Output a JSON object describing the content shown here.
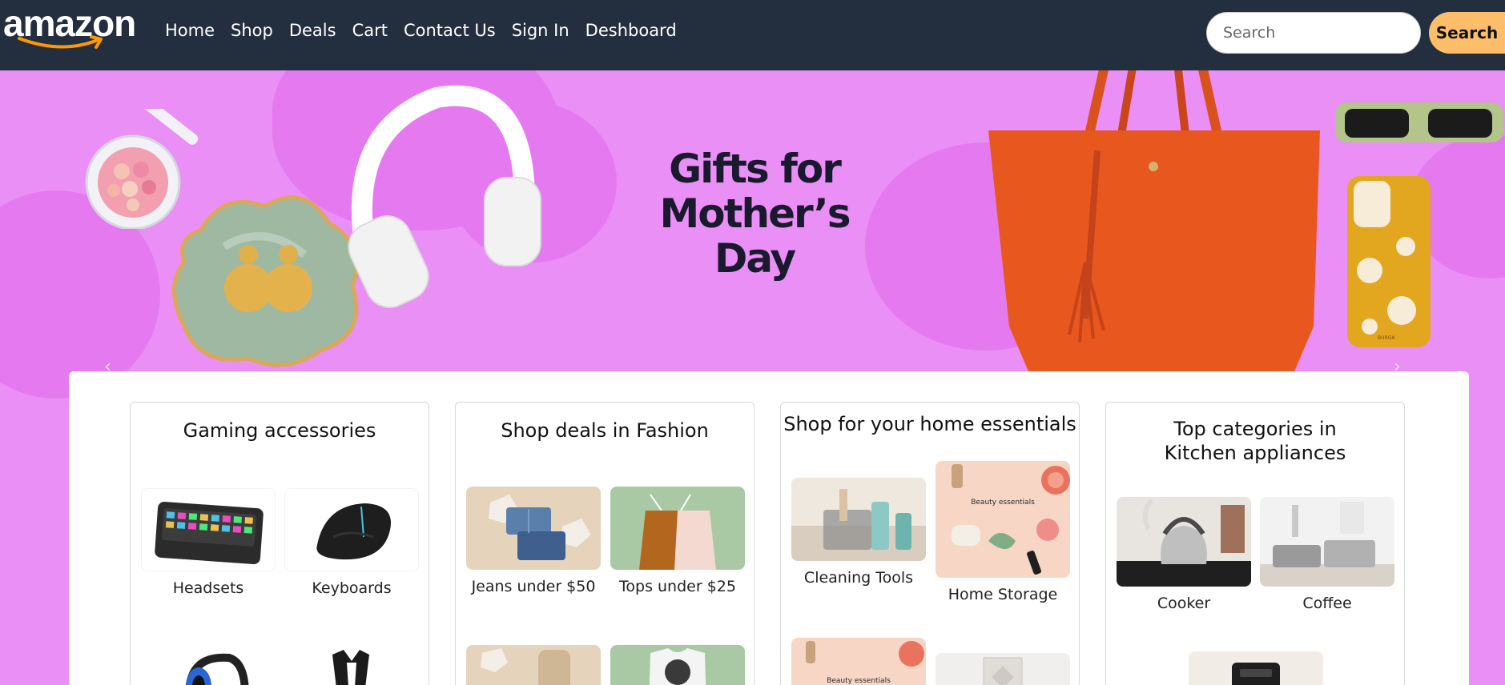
{
  "brand": {
    "logo_text": "amazon"
  },
  "nav": {
    "links": [
      "Home",
      "Shop",
      "Deals",
      "Cart",
      "Contact Us",
      "Sign In",
      "Deshboard"
    ]
  },
  "search": {
    "placeholder": "Search",
    "button_label": "Search"
  },
  "hero": {
    "title_line1": "Gifts for",
    "title_line2": "Mother’s Day",
    "phone_case_text": "BURGA",
    "colors": {
      "background": "#ea8ff5",
      "blob": "#e57af0",
      "bag": "#e8571e"
    }
  },
  "cards": [
    {
      "title": "Gaming accessories",
      "items": [
        {
          "label": "Headsets",
          "icon": "keyboard-image"
        },
        {
          "label": "Keyboards",
          "icon": "mouse-image"
        },
        {
          "label": "",
          "icon": "headset-image"
        },
        {
          "label": "",
          "icon": "gaming-chair-image"
        }
      ]
    },
    {
      "title": "Shop deals in Fashion",
      "items": [
        {
          "label": "Jeans under $50",
          "icon": "jeans-image"
        },
        {
          "label": "Tops under $25",
          "icon": "tops-image"
        },
        {
          "label": "",
          "icon": "dress-image"
        },
        {
          "label": "",
          "icon": "tshirt-image"
        }
      ]
    },
    {
      "title": "Shop for your home essentials",
      "items": [
        {
          "label": "Cleaning Tools",
          "icon": "cleaning-tools-image"
        },
        {
          "label": "Home Storage",
          "icon": "beauty-essentials-image"
        },
        {
          "label": "",
          "icon": "beauty-essentials-image"
        },
        {
          "label": "",
          "icon": "home-decor-image"
        }
      ],
      "image_text": "Beauty essentials"
    },
    {
      "title": "Top categories in Kitchen appliances",
      "items": [
        {
          "label": "Cooker",
          "icon": "kettle-image"
        },
        {
          "label": "Coffee",
          "icon": "cookware-image"
        },
        {
          "label": "",
          "icon": "coffee-maker-image"
        }
      ]
    }
  ],
  "colors": {
    "navbar": "#232f3e",
    "search_button": "#febd69"
  }
}
